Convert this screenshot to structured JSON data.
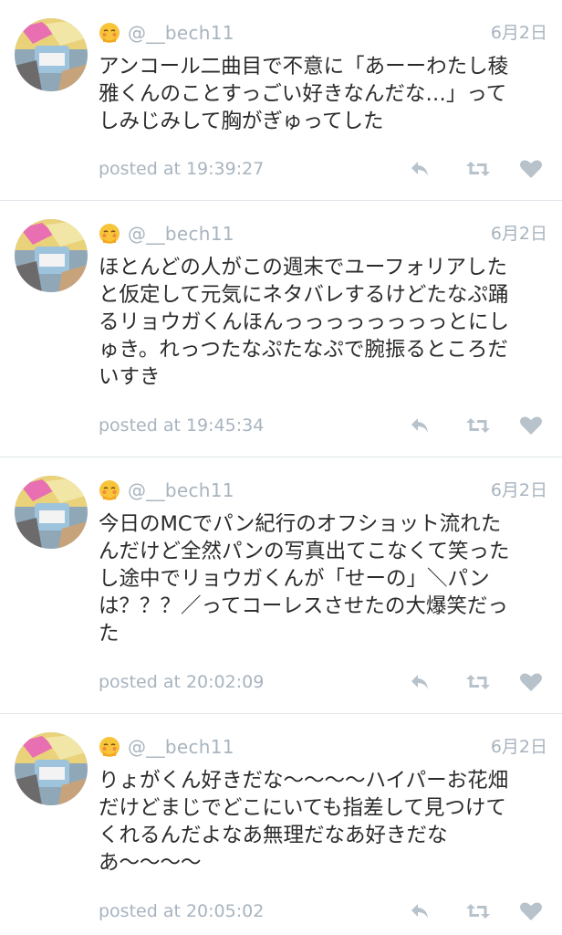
{
  "colors": {
    "meta_gray": "#a8b4bf",
    "icon_gray": "#b8c2cb",
    "text": "#2b2b2b",
    "divider": "#e1e6ea",
    "emoji_yellow": "#f7c43a"
  },
  "tweets": [
    {
      "handle": "@__bech11",
      "date": "6月2日",
      "text": "アンコール二曲目で不意に「あーーわたし稜\n雅くんのことすっごい好きなんだな…」って\nしみじみして胸がぎゅってした",
      "posted": "posted at 19:39:27",
      "icons": [
        "reply-icon",
        "retweet-icon",
        "heart-icon"
      ]
    },
    {
      "handle": "@__bech11",
      "date": "6月2日",
      "text": "ほとんどの人がこの週末でユーフォリアした\nと仮定して元気にネタバレするけどたなぷ踊\nるリョウガくんほんっっっっっっっっとにし\nゅき。れっつたなぷたなぷで腕振るところだ\nいすき",
      "posted": "posted at 19:45:34",
      "icons": [
        "reply-icon",
        "retweet-icon",
        "heart-icon"
      ]
    },
    {
      "handle": "@__bech11",
      "date": "6月2日",
      "text": "今日のMCでパン紀行のオフショット流れた\nんだけど全然パンの写真出てこなくて笑った\nし途中でリョウガくんが「せーの」＼パン\nは？？？／ってコーレスさせたの大爆笑だっ\nた",
      "posted": "posted at 20:02:09",
      "icons": [
        "reply-icon",
        "retweet-icon",
        "heart-icon"
      ]
    },
    {
      "handle": "@__bech11",
      "date": "6月2日",
      "text": "りょがくん好きだな〜〜〜〜ハイパーお花畑\nだけどまじでどこにいても指差して見つけて\nくれるんだよなあ無理だなあ好きだな\nあ〜〜〜〜",
      "posted": "posted at 20:05:02",
      "icons": [
        "reply-icon",
        "retweet-icon",
        "heart-icon"
      ]
    }
  ]
}
